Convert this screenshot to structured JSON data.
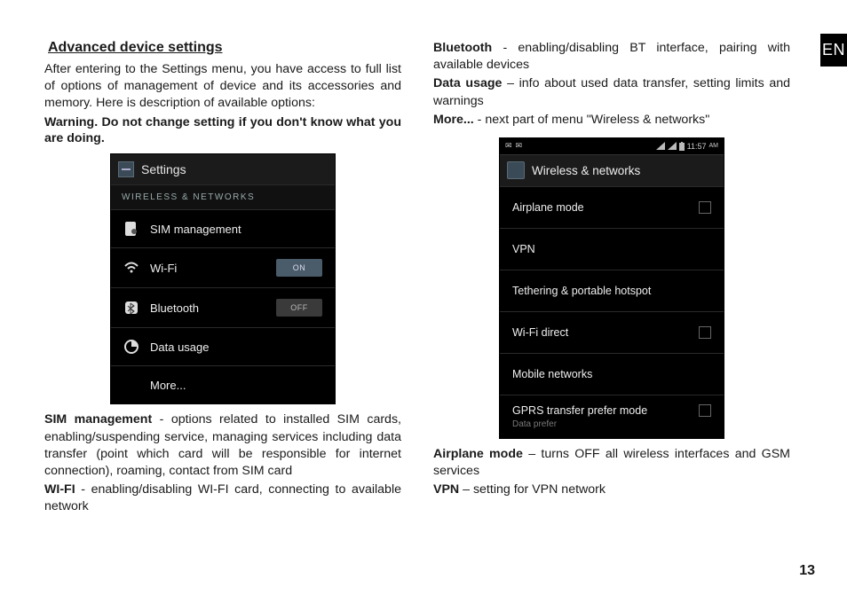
{
  "lang_badge": "EN",
  "page_number": "13",
  "section_title": "Advanced device settings",
  "intro": "After entering to the Settings menu, you have access to full list of options of management of device and its accessories and memory. Here is description of available options:",
  "warning": "Warning. Do not change setting if you don't know what you are doing.",
  "shot1": {
    "title": "Settings",
    "subhead": "WIRELESS & NETWORKS",
    "rows": {
      "sim": "SIM management",
      "wifi": "Wi-Fi",
      "wifi_toggle": "ON",
      "bt": "Bluetooth",
      "bt_toggle": "OFF",
      "data": "Data usage",
      "more": "More..."
    }
  },
  "defs_left": {
    "sim_t": "SIM management",
    "sim_b": " - options related to installed SIM cards, enabling/suspending service, managing services including data transfer (point which card will be responsible for internet connection), roaming, contact from SIM card",
    "wifi_t": "WI-FI",
    "wifi_b": " - enabling/disabling WI-FI card, connecting to available network"
  },
  "defs_right_top": {
    "bt_t": "Bluetooth",
    "bt_b": " - enabling/disabling BT interface, pairing with available devices",
    "du_t": "Data usage",
    "du_b": " – info about used data transfer, setting limits and warnings",
    "more_t": "More...",
    "more_b": " - next part of menu \"Wireless & networks\""
  },
  "shot2": {
    "status_time": "11:57",
    "status_ampm": "AM",
    "title": "Wireless & networks",
    "rows": {
      "airplane": "Airplane mode",
      "vpn": "VPN",
      "tether": "Tethering & portable hotspot",
      "wfd": "Wi-Fi direct",
      "mob": "Mobile networks",
      "gprs": "GPRS transfer prefer mode",
      "gprs_sub": "Data prefer"
    }
  },
  "defs_right_bottom": {
    "air_t": "Airplane mode",
    "air_b": " – turns OFF all wireless interfaces and GSM services",
    "vpn_t": "VPN",
    "vpn_b": " – setting for VPN network"
  }
}
